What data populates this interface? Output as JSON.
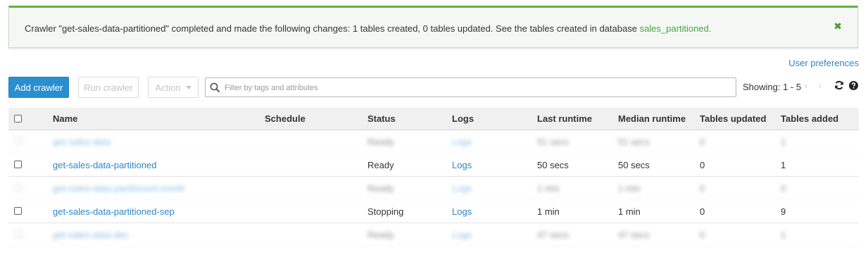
{
  "banner": {
    "message": "Crawler \"get-sales-data-partitioned\" completed and made the following changes: 1 tables created, 0 tables updated. See the tables created in database ",
    "database_link": "sales_partitioned.",
    "close": "✖"
  },
  "user_preferences": "User preferences",
  "toolbar": {
    "add_crawler": "Add crawler",
    "run_crawler": "Run crawler",
    "action": "Action",
    "filter_placeholder": "Filter by tags and attributes",
    "showing": "Showing: 1 - 5",
    "prev": "‹",
    "next": "›"
  },
  "table": {
    "headers": {
      "name": "Name",
      "schedule": "Schedule",
      "status": "Status",
      "logs": "Logs",
      "last_runtime": "Last runtime",
      "median_runtime": "Median runtime",
      "tables_updated": "Tables updated",
      "tables_added": "Tables added"
    },
    "rows": [
      {
        "name": "get-sales-data",
        "schedule": "",
        "status": "Ready",
        "logs": "Logs",
        "last_runtime": "51 secs",
        "median_runtime": "51 secs",
        "tables_updated": "0",
        "tables_added": "1",
        "blurred": true
      },
      {
        "name": "get-sales-data-partitioned",
        "schedule": "",
        "status": "Ready",
        "logs": "Logs",
        "last_runtime": "50 secs",
        "median_runtime": "50 secs",
        "tables_updated": "0",
        "tables_added": "1",
        "blurred": false
      },
      {
        "name": "get-sales-data-partitioned-month",
        "schedule": "",
        "status": "Ready",
        "logs": "Logs",
        "last_runtime": "1 min",
        "median_runtime": "1 min",
        "tables_updated": "0",
        "tables_added": "0",
        "blurred": true
      },
      {
        "name": "get-sales-data-partitioned-sep",
        "schedule": "",
        "status": "Stopping",
        "logs": "Logs",
        "last_runtime": "1 min",
        "median_runtime": "1 min",
        "tables_updated": "0",
        "tables_added": "9",
        "blurred": false
      },
      {
        "name": "get-sales-data-dec",
        "schedule": "",
        "status": "Ready",
        "logs": "Logs",
        "last_runtime": "47 secs",
        "median_runtime": "47 secs",
        "tables_updated": "0",
        "tables_added": "1",
        "blurred": true
      }
    ]
  },
  "colors": {
    "primary_button": "#2a8fd0",
    "link": "#2c86c8",
    "success": "#5eb33b"
  },
  "icons": [
    "close-icon",
    "search-icon",
    "caret-down-icon",
    "refresh-icon",
    "help-icon"
  ]
}
